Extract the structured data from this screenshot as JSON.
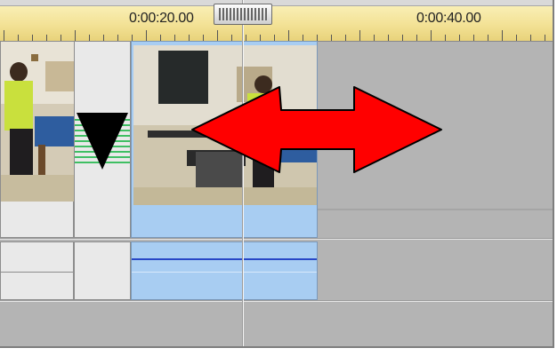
{
  "ruler": {
    "time_marks": [
      "0:00:20.00",
      "0:00:40.00"
    ]
  },
  "colors": {
    "ruler_bg": "#f3e296",
    "track_bg": "#b4b4b4",
    "selected_clip": "#a8cdf2",
    "arrow": "#ff0000",
    "transition_green": "#45c76b"
  },
  "icons": {
    "playhead": "playhead-handle-icon",
    "resize": "horizontal-resize-arrow-icon",
    "transition": "transition-triangle-icon"
  }
}
